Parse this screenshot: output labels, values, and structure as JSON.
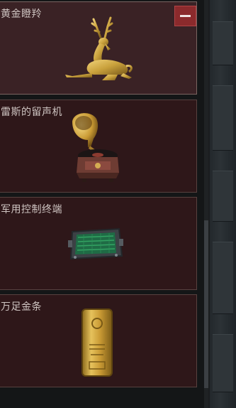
{
  "inventory": {
    "items": [
      {
        "name": "黄金瞪羚",
        "icon": "golden-gazelle-statue-icon",
        "selected": true
      },
      {
        "name": "雷斯的留声机",
        "icon": "gramophone-icon",
        "selected": false
      },
      {
        "name": "军用控制终端",
        "icon": "military-control-terminal-icon",
        "selected": false
      },
      {
        "name": "万足金条",
        "icon": "gold-bar-icon",
        "selected": false
      }
    ],
    "remove_button_icon": "minus-icon"
  },
  "colors": {
    "card_background": "#2e1719",
    "card_selected_background": "#3a2225",
    "remove_button": "#8b2a2c",
    "gold": "#c9a13c"
  }
}
